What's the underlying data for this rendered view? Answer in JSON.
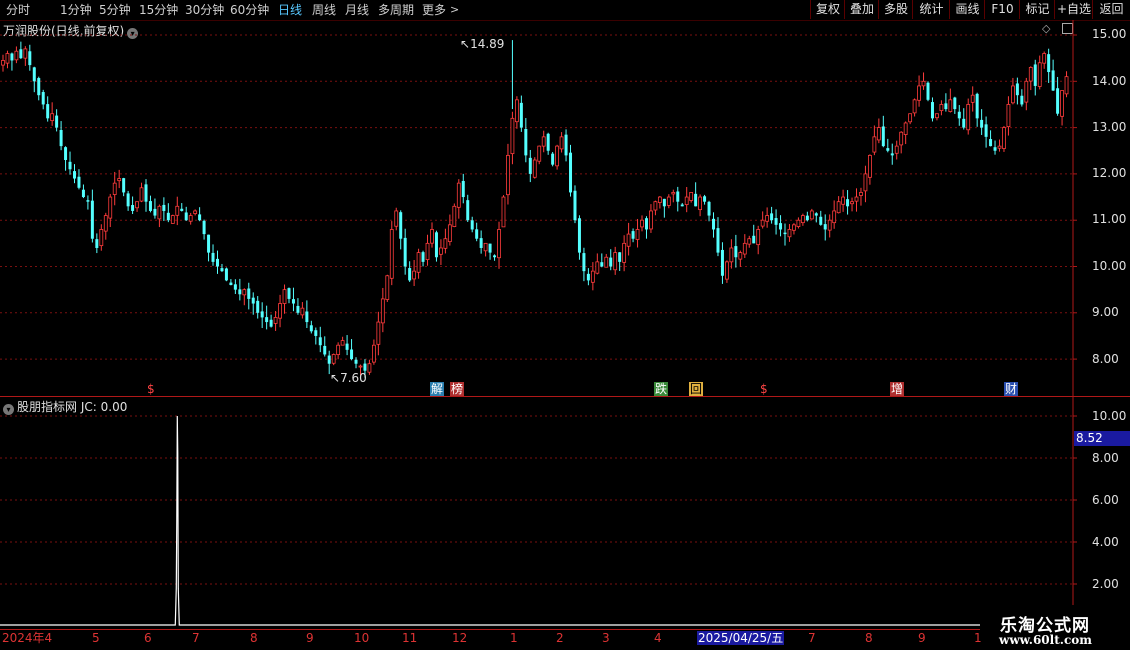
{
  "toolbar": {
    "periods": [
      "分时",
      "1分钟",
      "5分钟",
      "15分钟",
      "30分钟",
      "60分钟",
      "日线",
      "周线",
      "月线",
      "多周期",
      "更多"
    ],
    "active_period": "日线",
    "buttons": [
      "复权",
      "叠加",
      "多股",
      "统计",
      "画线",
      "F10",
      "标记",
      "+自选",
      "返回"
    ]
  },
  "main_chart": {
    "title": "万润股份(日线,前复权)",
    "high_label": "14.89",
    "low_label": "7.60",
    "y_ticks": [
      "15.00",
      "14.00",
      "13.00",
      "12.00",
      "11.00",
      "10.00",
      "9.00",
      "8.00"
    ],
    "markers": [
      {
        "text": "$",
        "kind": "dollar"
      },
      {
        "text": "解",
        "kind": "unlock"
      },
      {
        "text": "榜",
        "kind": "rank"
      },
      {
        "text": "跌",
        "kind": "fall"
      },
      {
        "text": "回",
        "kind": "back"
      },
      {
        "text": "$",
        "kind": "dollar"
      },
      {
        "text": "增",
        "kind": "add"
      },
      {
        "text": "财",
        "kind": "finance"
      }
    ]
  },
  "indicator": {
    "title": "股朋指标网",
    "value_label": "JC: 0.00",
    "y_ticks": [
      "10.00",
      "8.00",
      "6.00",
      "4.00",
      "2.00"
    ],
    "current_value": "8.52"
  },
  "x_axis": {
    "labels": [
      "2024年4",
      "5",
      "6",
      "7",
      "8",
      "9",
      "10",
      "11",
      "12",
      "1",
      "2",
      "3",
      "4",
      "2025/04/25/五",
      "7",
      "8",
      "9",
      "1"
    ]
  },
  "watermark": {
    "line1": "乐淘公式网",
    "line2": "www.60lt.com"
  },
  "colors": {
    "up": "#ff3c3c",
    "down": "#54ffff",
    "grid": "#7a1010",
    "axis": "#b01818",
    "accent": "#58c8ff"
  },
  "chart_data": {
    "type": "candlestick",
    "y_range": [
      7.3,
      15.3
    ],
    "close_path": [
      [
        0,
        14.45
      ],
      [
        1,
        14.6
      ],
      [
        2,
        14.45
      ],
      [
        3,
        14.65
      ],
      [
        4,
        14.5
      ],
      [
        5,
        14.7
      ],
      [
        6,
        14.35
      ],
      [
        7,
        14.0
      ],
      [
        8,
        13.7
      ],
      [
        9,
        13.5
      ],
      [
        10,
        13.2
      ],
      [
        11,
        13.3
      ],
      [
        12,
        13.0
      ],
      [
        13,
        12.6
      ],
      [
        14,
        12.3
      ],
      [
        15,
        12.1
      ],
      [
        16,
        11.9
      ],
      [
        17,
        11.7
      ],
      [
        18,
        11.5
      ],
      [
        19,
        11.4
      ],
      [
        20,
        10.6
      ],
      [
        21,
        10.4
      ],
      [
        22,
        10.8
      ],
      [
        23,
        11.1
      ],
      [
        24,
        11.5
      ],
      [
        25,
        11.8
      ],
      [
        26,
        11.9
      ],
      [
        27,
        11.6
      ],
      [
        28,
        11.3
      ],
      [
        29,
        11.2
      ],
      [
        30,
        11.4
      ],
      [
        31,
        11.7
      ],
      [
        32,
        11.4
      ],
      [
        33,
        11.2
      ],
      [
        34,
        11.1
      ],
      [
        35,
        11.3
      ],
      [
        36,
        11.2
      ],
      [
        37,
        11.0
      ],
      [
        38,
        11.1
      ],
      [
        39,
        11.3
      ],
      [
        40,
        11.2
      ],
      [
        41,
        11.0
      ],
      [
        42,
        11.1
      ],
      [
        43,
        11.2
      ],
      [
        44,
        11.0
      ],
      [
        45,
        10.7
      ],
      [
        46,
        10.3
      ],
      [
        47,
        10.1
      ],
      [
        48,
        10.0
      ],
      [
        49,
        9.9
      ],
      [
        50,
        9.7
      ],
      [
        51,
        9.6
      ],
      [
        52,
        9.5
      ],
      [
        53,
        9.4
      ],
      [
        54,
        9.5
      ],
      [
        55,
        9.3
      ],
      [
        56,
        9.2
      ],
      [
        57,
        9.0
      ],
      [
        58,
        8.9
      ],
      [
        59,
        8.8
      ],
      [
        60,
        8.7
      ],
      [
        61,
        8.9
      ],
      [
        62,
        9.2
      ],
      [
        63,
        9.5
      ],
      [
        64,
        9.3
      ],
      [
        65,
        9.2
      ],
      [
        66,
        9.0
      ],
      [
        67,
        9.1
      ],
      [
        68,
        8.8
      ],
      [
        69,
        8.6
      ],
      [
        70,
        8.5
      ],
      [
        71,
        8.3
      ],
      [
        72,
        8.1
      ],
      [
        73,
        7.9
      ],
      [
        74,
        8.1
      ],
      [
        75,
        8.3
      ],
      [
        76,
        8.4
      ],
      [
        77,
        8.2
      ],
      [
        78,
        8.0
      ],
      [
        79,
        7.9
      ],
      [
        80,
        7.85
      ],
      [
        81,
        7.75
      ],
      [
        82,
        7.9
      ],
      [
        83,
        8.3
      ],
      [
        84,
        8.8
      ],
      [
        85,
        9.3
      ],
      [
        86,
        9.8
      ],
      [
        87,
        10.8
      ],
      [
        88,
        11.2
      ],
      [
        89,
        10.6
      ],
      [
        90,
        10.0
      ],
      [
        91,
        9.7
      ],
      [
        92,
        9.9
      ],
      [
        93,
        10.3
      ],
      [
        94,
        10.1
      ],
      [
        95,
        10.5
      ],
      [
        96,
        10.8
      ],
      [
        97,
        10.2
      ],
      [
        98,
        10.4
      ],
      [
        99,
        10.6
      ],
      [
        100,
        10.9
      ],
      [
        101,
        11.3
      ],
      [
        102,
        11.8
      ],
      [
        103,
        11.5
      ],
      [
        104,
        11.0
      ],
      [
        105,
        10.8
      ],
      [
        106,
        10.6
      ],
      [
        107,
        10.4
      ],
      [
        108,
        10.5
      ],
      [
        109,
        10.3
      ],
      [
        110,
        10.2
      ],
      [
        111,
        10.8
      ],
      [
        112,
        11.5
      ],
      [
        113,
        12.4
      ],
      [
        114,
        13.2
      ],
      [
        115,
        13.6
      ],
      [
        116,
        13.0
      ],
      [
        117,
        12.4
      ],
      [
        118,
        12.0
      ],
      [
        119,
        12.3
      ],
      [
        120,
        12.6
      ],
      [
        121,
        12.8
      ],
      [
        122,
        12.5
      ],
      [
        123,
        12.2
      ],
      [
        124,
        12.6
      ],
      [
        125,
        12.8
      ],
      [
        126,
        12.4
      ],
      [
        127,
        11.6
      ],
      [
        128,
        11.0
      ],
      [
        129,
        10.3
      ],
      [
        130,
        9.9
      ],
      [
        131,
        9.7
      ],
      [
        132,
        9.9
      ],
      [
        133,
        10.1
      ],
      [
        134,
        10.0
      ],
      [
        135,
        10.2
      ],
      [
        136,
        10.0
      ],
      [
        137,
        10.3
      ],
      [
        138,
        10.1
      ],
      [
        139,
        10.5
      ],
      [
        140,
        10.7
      ],
      [
        141,
        10.6
      ],
      [
        142,
        10.8
      ],
      [
        143,
        11.0
      ],
      [
        144,
        10.8
      ],
      [
        145,
        11.2
      ],
      [
        146,
        11.4
      ],
      [
        147,
        11.5
      ],
      [
        148,
        11.3
      ],
      [
        149,
        11.5
      ],
      [
        150,
        11.6
      ],
      [
        151,
        11.4
      ],
      [
        152,
        11.3
      ],
      [
        153,
        11.5
      ],
      [
        154,
        11.6
      ],
      [
        155,
        11.3
      ],
      [
        156,
        11.5
      ],
      [
        157,
        11.4
      ],
      [
        158,
        11.1
      ],
      [
        159,
        10.8
      ],
      [
        160,
        10.3
      ],
      [
        161,
        9.8
      ],
      [
        162,
        10.1
      ],
      [
        163,
        10.4
      ],
      [
        164,
        10.2
      ],
      [
        165,
        10.3
      ],
      [
        166,
        10.5
      ],
      [
        167,
        10.6
      ],
      [
        168,
        10.5
      ],
      [
        169,
        10.8
      ],
      [
        170,
        11.0
      ],
      [
        171,
        11.1
      ],
      [
        172,
        11.0
      ],
      [
        173,
        10.9
      ],
      [
        174,
        10.8
      ],
      [
        175,
        10.7
      ],
      [
        176,
        10.8
      ],
      [
        177,
        10.9
      ],
      [
        178,
        11.0
      ],
      [
        179,
        11.1
      ],
      [
        180,
        11.0
      ],
      [
        181,
        11.2
      ],
      [
        182,
        11.1
      ],
      [
        183,
        10.9
      ],
      [
        184,
        10.8
      ],
      [
        185,
        11.0
      ],
      [
        186,
        11.2
      ],
      [
        187,
        11.4
      ],
      [
        188,
        11.5
      ],
      [
        189,
        11.3
      ],
      [
        190,
        11.4
      ],
      [
        191,
        11.5
      ],
      [
        192,
        11.6
      ],
      [
        193,
        12.0
      ],
      [
        194,
        12.4
      ],
      [
        195,
        12.8
      ],
      [
        196,
        13.0
      ],
      [
        197,
        12.6
      ],
      [
        198,
        12.5
      ],
      [
        199,
        12.4
      ],
      [
        200,
        12.6
      ],
      [
        201,
        12.9
      ],
      [
        202,
        13.1
      ],
      [
        203,
        13.3
      ],
      [
        204,
        13.6
      ],
      [
        205,
        13.9
      ],
      [
        206,
        14.0
      ],
      [
        207,
        13.6
      ],
      [
        208,
        13.2
      ],
      [
        209,
        13.3
      ],
      [
        210,
        13.5
      ],
      [
        211,
        13.4
      ],
      [
        212,
        13.6
      ],
      [
        213,
        13.4
      ],
      [
        214,
        13.2
      ],
      [
        215,
        13.0
      ],
      [
        216,
        13.5
      ],
      [
        217,
        13.7
      ],
      [
        218,
        13.2
      ],
      [
        219,
        13.0
      ],
      [
        220,
        12.8
      ],
      [
        221,
        12.6
      ],
      [
        222,
        12.5
      ],
      [
        223,
        12.6
      ],
      [
        224,
        13.0
      ],
      [
        225,
        13.5
      ],
      [
        226,
        13.9
      ],
      [
        227,
        13.7
      ],
      [
        228,
        13.5
      ],
      [
        229,
        14.0
      ],
      [
        230,
        14.3
      ],
      [
        231,
        13.9
      ],
      [
        232,
        14.4
      ],
      [
        233,
        14.6
      ],
      [
        234,
        14.2
      ],
      [
        235,
        13.8
      ],
      [
        236,
        13.3
      ],
      [
        237,
        13.8
      ],
      [
        238,
        14.1
      ]
    ],
    "annotations": {
      "high": 14.89,
      "low": 7.6
    },
    "indicator": {
      "name": "JC",
      "range": [
        0,
        11
      ],
      "baseline": 0,
      "spike": {
        "bar_index": 39,
        "value": 10.0
      },
      "current_value": 8.52
    },
    "x_tick_labels": [
      "2024年4",
      "5",
      "6",
      "7",
      "8",
      "9",
      "10",
      "11",
      "12",
      "1",
      "2",
      "3",
      "4",
      "2025/04/25/五",
      "7",
      "8",
      "9",
      "1"
    ]
  }
}
